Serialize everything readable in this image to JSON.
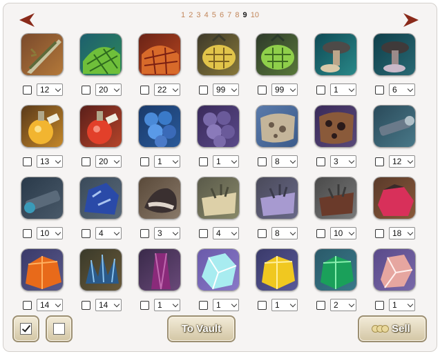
{
  "pagination": {
    "pages": [
      "1",
      "2",
      "3",
      "4",
      "5",
      "6",
      "7",
      "8",
      "9",
      "10"
    ],
    "current": "9"
  },
  "colors": {
    "page_link": "#c2865a",
    "nav_arrow": "#8a2a1a",
    "panel_bg": "#f6f4f3",
    "button_face": "#e4dac0"
  },
  "items": [
    {
      "icon": "feather-icon",
      "qty": "12",
      "checked": false
    },
    {
      "icon": "green-net-icon",
      "qty": "20",
      "checked": false
    },
    {
      "icon": "red-net-icon",
      "qty": "22",
      "checked": false
    },
    {
      "icon": "yellow-pinecone-icon",
      "qty": "99",
      "checked": false
    },
    {
      "icon": "green-pinecone-icon",
      "qty": "99",
      "checked": false
    },
    {
      "icon": "teal-mushroom-icon",
      "qty": "1",
      "checked": false
    },
    {
      "icon": "dark-mushroom-icon",
      "qty": "6",
      "checked": false
    },
    {
      "icon": "yellow-potion-icon",
      "qty": "13",
      "checked": false
    },
    {
      "icon": "red-potion-icon",
      "qty": "20",
      "checked": false
    },
    {
      "icon": "blue-eggs-icon",
      "qty": "1",
      "checked": false
    },
    {
      "icon": "purple-eggs-icon",
      "qty": "1",
      "checked": false
    },
    {
      "icon": "spotted-hide-icon",
      "qty": "8",
      "checked": false
    },
    {
      "icon": "leopard-hide-icon",
      "qty": "3",
      "checked": false
    },
    {
      "icon": "spyglass-icon",
      "qty": "12",
      "checked": false
    },
    {
      "icon": "telescope-icon",
      "qty": "10",
      "checked": false
    },
    {
      "icon": "blue-stone-icon",
      "qty": "4",
      "checked": false
    },
    {
      "icon": "fur-bundle-icon",
      "qty": "3",
      "checked": false
    },
    {
      "icon": "tan-cloth-icon",
      "qty": "4",
      "checked": false
    },
    {
      "icon": "lilac-cloth-icon",
      "qty": "8",
      "checked": false
    },
    {
      "icon": "brown-cloth-icon",
      "qty": "10",
      "checked": false
    },
    {
      "icon": "red-ore-icon",
      "qty": "18",
      "checked": false
    },
    {
      "icon": "orange-crystal-icon",
      "qty": "14",
      "checked": false
    },
    {
      "icon": "blue-crystal-cluster-icon",
      "qty": "14",
      "checked": false
    },
    {
      "icon": "amethyst-shard-icon",
      "qty": "1",
      "checked": false
    },
    {
      "icon": "ice-crystal-icon",
      "qty": "1",
      "checked": false
    },
    {
      "icon": "gold-crystal-icon",
      "qty": "1",
      "checked": false
    },
    {
      "icon": "emerald-crystal-icon",
      "qty": "2",
      "checked": false
    },
    {
      "icon": "rose-quartz-icon",
      "qty": "1",
      "checked": false
    }
  ],
  "buttons": {
    "to_vault": "To Vault",
    "sell": "Sell"
  }
}
